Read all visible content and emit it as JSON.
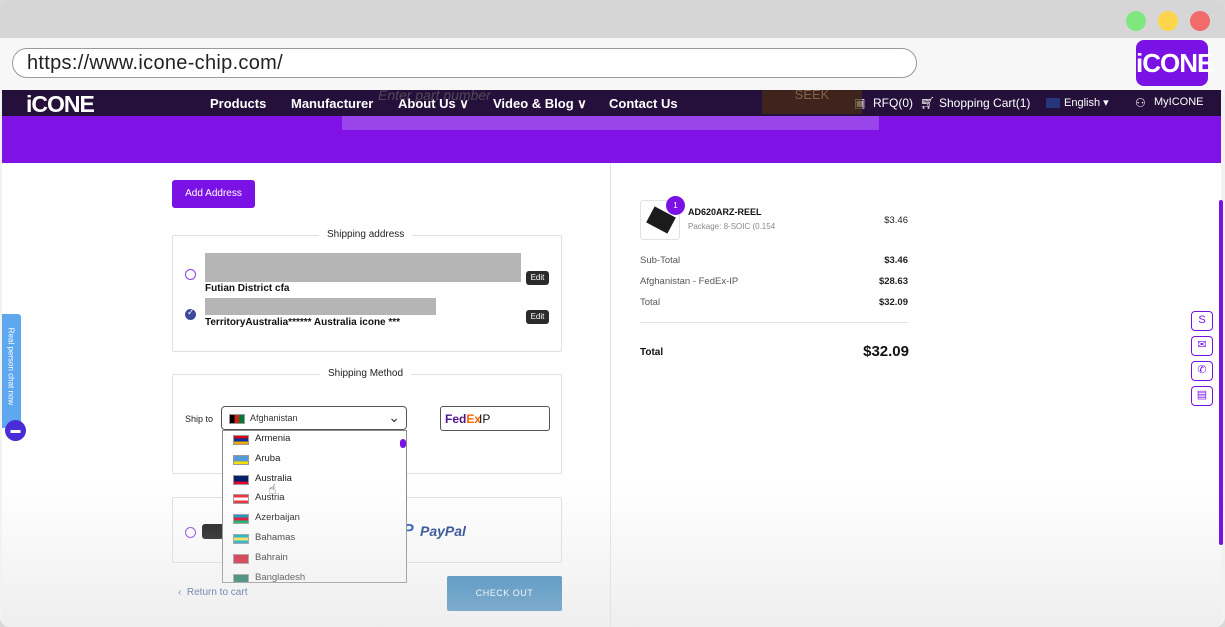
{
  "browser": {
    "url": "https://www.icone-chip.com/",
    "corner_logo": "iCONE"
  },
  "nav": {
    "logo": "iCONE",
    "items": [
      "Products",
      "Manufacturer",
      "About Us ∨",
      "Video & Blog ∨",
      "Contact Us"
    ],
    "rfq": "RFQ(0)",
    "cart": "Shopping Cart(1)",
    "language": "English ▾",
    "account": "MyICONE",
    "search_placeholder": "Enter part number",
    "search_button": "SEEK"
  },
  "left": {
    "add_address": "Add Address",
    "shipping_address_title": "Shipping address",
    "addresses": [
      {
        "text": "Futian District cfa",
        "selected": false,
        "edit": "Edit"
      },
      {
        "text": "TerritoryAustralia****** Australia icone ***",
        "selected": true,
        "edit": "Edit"
      }
    ],
    "shipping_method_title": "Shipping Method",
    "ship_to_label": "Ship to",
    "selected_country": "Afghanistan",
    "carrier_fedex_a": "Fed",
    "carrier_fedex_b": "Ex",
    "carrier_service": "IP",
    "countries": [
      {
        "name": "Armenia",
        "flag": [
          "#d90012",
          "#0033a0",
          "#f2a800"
        ]
      },
      {
        "name": "Aruba",
        "flag": [
          "#5b9bd5",
          "#5b9bd5",
          "#f5e000"
        ]
      },
      {
        "name": "Australia",
        "flag": [
          "#012169",
          "#012169",
          "#e4002b"
        ]
      },
      {
        "name": "Austria",
        "flag": [
          "#ed2939",
          "#ffffff",
          "#ed2939"
        ]
      },
      {
        "name": "Azerbaijan",
        "flag": [
          "#0092bc",
          "#e4002b",
          "#00af66"
        ]
      },
      {
        "name": "Bahamas",
        "flag": [
          "#00abc9",
          "#fae042",
          "#00abc9"
        ]
      },
      {
        "name": "Bahrain",
        "flag": [
          "#ce1126",
          "#ce1126",
          "#ce1126"
        ]
      },
      {
        "name": "Bangladesh",
        "flag": [
          "#006a4e",
          "#006a4e",
          "#006a4e"
        ]
      }
    ],
    "paypal": "PayPal",
    "back_link": "Return to cart",
    "checkout": "CHECK OUT"
  },
  "summary": {
    "item_qty": "1",
    "item_name": "AD620ARZ-REEL",
    "item_package": "Package: 8-SOIC (0.154",
    "item_price": "$3.46",
    "rows": [
      {
        "label": "Sub-Total",
        "value": "$3.46"
      },
      {
        "label": "Afghanistan - FedEx-IP",
        "value": "$28.63"
      },
      {
        "label": "Total",
        "value": "$32.09"
      }
    ],
    "total_label": "Total",
    "total_value": "$32.09"
  },
  "chat": {
    "tab_text": "Real person chat now"
  },
  "colors": {
    "brand_purple": "#8112e6",
    "checkout_blue": "#1e78b8"
  }
}
